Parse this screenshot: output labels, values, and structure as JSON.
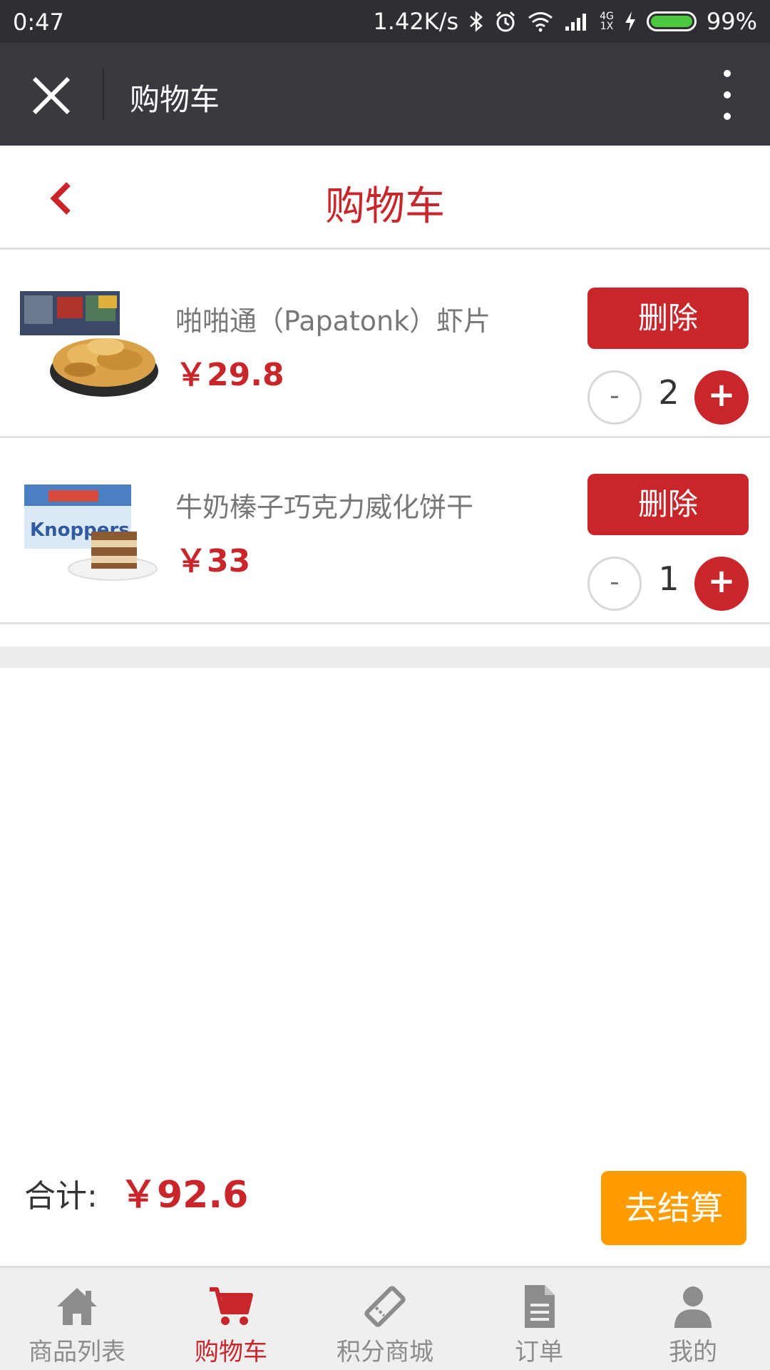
{
  "status_bar": {
    "time": "0:47",
    "speed": "1.42K/s",
    "network": "4G",
    "network_sub": "1X",
    "battery": "99%"
  },
  "title_bar": {
    "title": "购物车"
  },
  "page_header": {
    "title": "购物车"
  },
  "cart_items": [
    {
      "name": "啪啪通（Papatonk）虾片",
      "price": "￥29.8",
      "delete_label": "删除",
      "minus_label": "-",
      "quantity": "2",
      "plus_label": "+"
    },
    {
      "name": "牛奶榛子巧克力威化饼干",
      "price": "￥33",
      "delete_label": "删除",
      "minus_label": "-",
      "quantity": "1",
      "plus_label": "+"
    }
  ],
  "summary": {
    "total_label": "合计:",
    "total_value": "￥92.6",
    "checkout_label": "去结算"
  },
  "tabs": [
    {
      "label": "商品列表",
      "icon": "home-icon",
      "active": false
    },
    {
      "label": "购物车",
      "icon": "cart-icon",
      "active": true
    },
    {
      "label": "积分商城",
      "icon": "ticket-icon",
      "active": false
    },
    {
      "label": "订单",
      "icon": "document-icon",
      "active": false
    },
    {
      "label": "我的",
      "icon": "user-icon",
      "active": false
    }
  ],
  "colors": {
    "accent": "#c9262b",
    "checkout": "#ff9c00",
    "title_bar": "#393a3f",
    "status_bar": "#2e2f33"
  }
}
